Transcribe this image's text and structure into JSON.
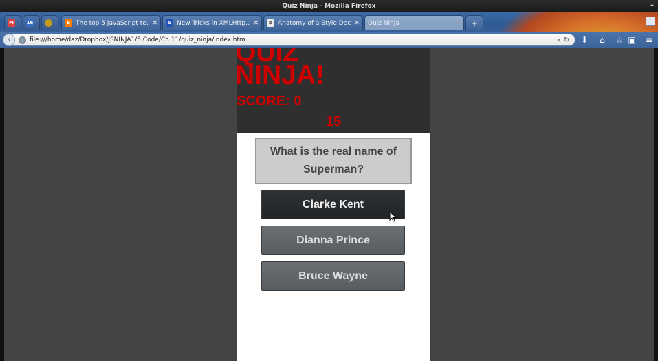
{
  "window": {
    "title": "Quiz Ninja - Mozilla Firefox",
    "minimize": "–"
  },
  "tabs": [
    {
      "label": "",
      "favicon": "gmail-icon",
      "color": "#d44"
    },
    {
      "label": "",
      "favicon": "calendar-icon",
      "color": "#3b6dc4"
    },
    {
      "label": "",
      "favicon": "extension-icon",
      "color": "#c39a1c"
    },
    {
      "label": "The top 5 JavaScript te…",
      "favicon": "blogger-icon",
      "color": "#f57d00"
    },
    {
      "label": "New Tricks in XMLHttp…",
      "favicon": "html5-icon",
      "color": "#2453b5"
    },
    {
      "label": "Anatomy of a Style Dec…",
      "favicon": "sitepoint-icon",
      "color": "#eaeaea"
    },
    {
      "label": "Quiz Ninja",
      "favicon": "page-icon",
      "color": "#ccc"
    }
  ],
  "navbar": {
    "url": "file:///home/daz/Dropbox/JSNINJA1/5 Code/Ch 11/quiz_ninja/index.htm",
    "icons": [
      "back-icon",
      "reload-icon",
      "download-icon",
      "home-icon",
      "bookmark-star-icon",
      "clipboard-icon",
      "menu-icon"
    ]
  },
  "quiz": {
    "logo": "QUIZ NINJA!",
    "score_label": "SCORE: 0",
    "timer": "15",
    "question": "What is the real name of Superman?",
    "answers": [
      "Clarke Kent",
      "Dianna Prince",
      "Bruce Wayne"
    ]
  },
  "colors": {
    "accent": "#cc0000",
    "header_bg": "#2f2f2f",
    "page_bg": "#444444"
  }
}
